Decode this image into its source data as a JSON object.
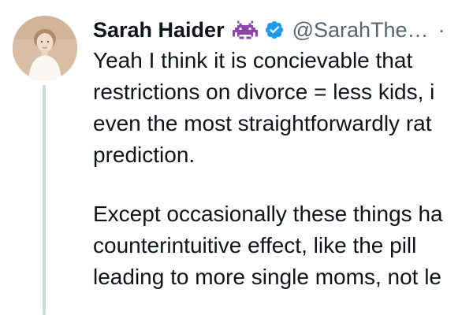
{
  "author": {
    "name": "Sarah Haider",
    "handle": "@SarahThe…",
    "separator": "·",
    "emoji_icon": "space-invader-icon",
    "verified_icon": "verified-badge-icon",
    "verified_color": "#1d9bf0"
  },
  "tweet": {
    "paragraph_1": [
      "Yeah I think it is concievable that",
      "restrictions on divorce = less kids, i",
      "even the most straightforwardly rat",
      "prediction."
    ],
    "paragraph_2": [
      "Except occasionally these things ha",
      "counterintuitive effect, like the pill",
      "leading to more single moms, not le"
    ]
  },
  "colors": {
    "text": "#0f1419",
    "secondary": "#536471",
    "thread_line": "#cfd9de",
    "alien_purple": "#8e44ad"
  }
}
